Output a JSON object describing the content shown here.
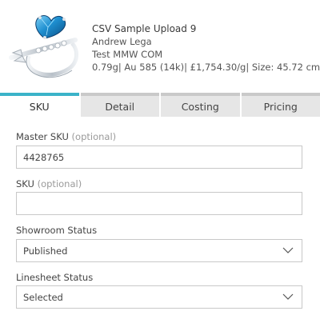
{
  "product": {
    "title": "CSV Sample Upload 9",
    "designer": "Andrew Lega",
    "account": "Test MMW COM",
    "details": "0.79g| Au 585 (14k)| £1,754.30/g| Size: 45.72 cm"
  },
  "tabs": [
    {
      "label": "SKU",
      "active": true
    },
    {
      "label": "Detail",
      "active": false
    },
    {
      "label": "Costing",
      "active": false
    },
    {
      "label": "Pricing",
      "active": false
    }
  ],
  "form": {
    "master_sku": {
      "label": "Master SKU",
      "optional": "(optional)",
      "value": "4428765"
    },
    "sku": {
      "label": "SKU",
      "optional": "(optional)",
      "value": ""
    },
    "showroom_status": {
      "label": "Showroom Status",
      "value": "Published"
    },
    "linesheet_status": {
      "label": "Linesheet Status",
      "value": "Selected"
    }
  },
  "colors": {
    "accent": "#3bb3c8",
    "tab_inactive_bg": "#e6e6e6",
    "heart_gem": "#1e8fd0",
    "metal": "#d8dde2"
  },
  "icons": {
    "product_image": "heart-ring-image",
    "select_chevron": "chevron-down-icon"
  }
}
